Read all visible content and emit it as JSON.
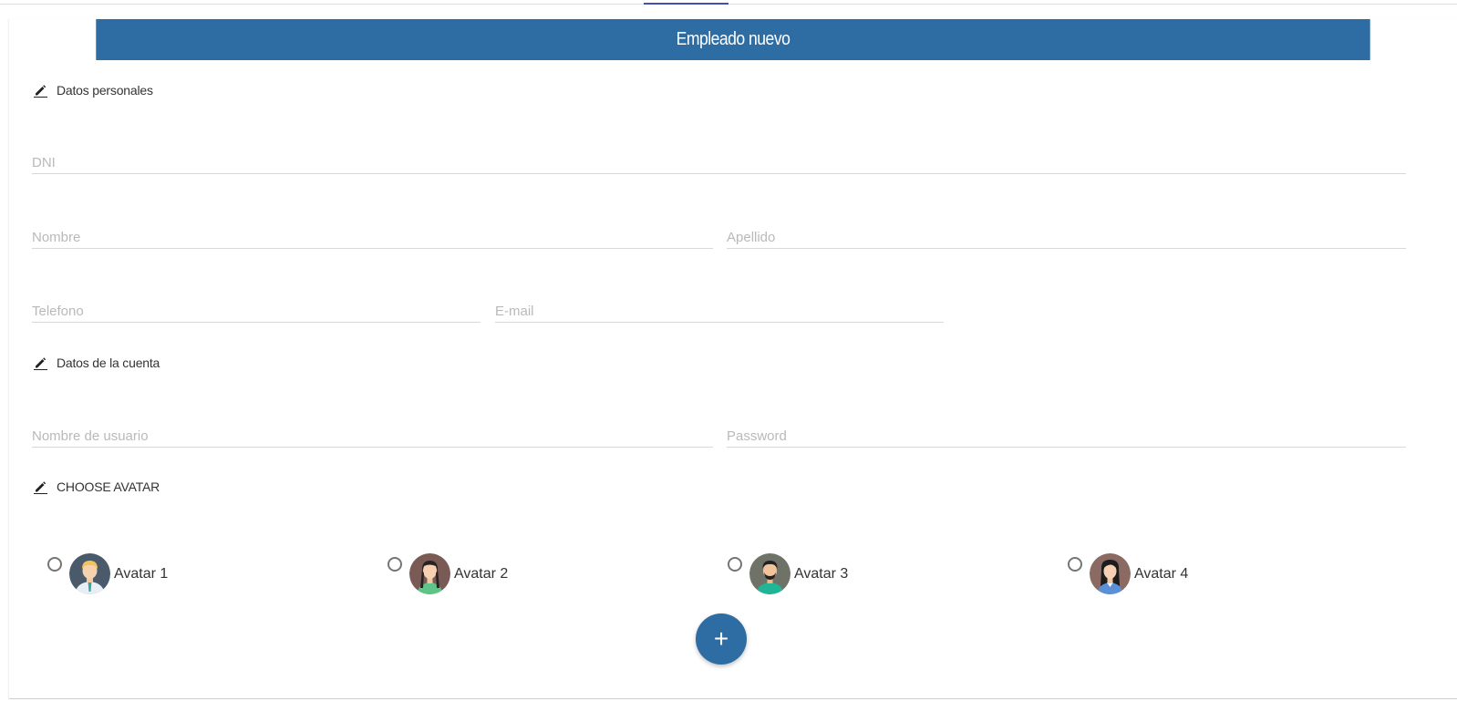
{
  "form": {
    "title": "Empleado nuevo",
    "sections": {
      "personal": "Datos personales",
      "account": "Datos de la cuenta",
      "avatar": "CHOOSE AVATAR"
    },
    "fields": {
      "dni": {
        "placeholder": "DNI",
        "value": ""
      },
      "nombre": {
        "placeholder": "Nombre",
        "value": ""
      },
      "apellido": {
        "placeholder": "Apellido",
        "value": ""
      },
      "telefono": {
        "placeholder": "Telefono",
        "value": ""
      },
      "email": {
        "placeholder": "E-mail",
        "value": ""
      },
      "usuario": {
        "placeholder": "Nombre de usuario",
        "value": ""
      },
      "password": {
        "placeholder": "Password",
        "value": ""
      }
    },
    "avatars": [
      {
        "label": "Avatar 1",
        "icon": "male-blonde-avatar-icon"
      },
      {
        "label": "Avatar 2",
        "icon": "female-braids-avatar-icon"
      },
      {
        "label": "Avatar 3",
        "icon": "male-beard-avatar-icon"
      },
      {
        "label": "Avatar 4",
        "icon": "female-dark-hair-avatar-icon"
      }
    ],
    "add_button": "+",
    "colors": {
      "primary": "#2e6da4",
      "tab_indicator": "#3f51b5"
    }
  }
}
